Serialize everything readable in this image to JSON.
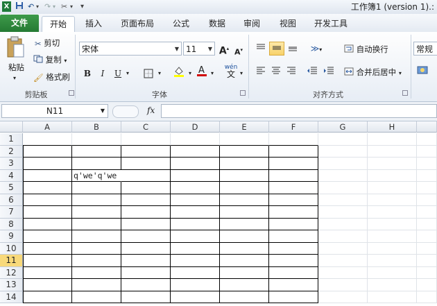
{
  "window": {
    "title": "工作簿1 (version 1).:"
  },
  "quick_access": {
    "excel_icon": "excel-icon",
    "save_icon": "save-icon",
    "undo_icon": "undo-icon",
    "redo_icon": "redo-icon",
    "customize": "▾"
  },
  "tabs": [
    {
      "label": "文件",
      "type": "file"
    },
    {
      "label": "开始",
      "active": true
    },
    {
      "label": "插入"
    },
    {
      "label": "页面布局"
    },
    {
      "label": "公式"
    },
    {
      "label": "数据"
    },
    {
      "label": "审阅"
    },
    {
      "label": "视图"
    },
    {
      "label": "开发工具"
    }
  ],
  "clipboard": {
    "paste_label": "粘贴",
    "cut_label": "剪切",
    "copy_label": "复制",
    "format_painter_label": "格式刷",
    "group_label": "剪贴板"
  },
  "font": {
    "name": "宋体",
    "size": "11",
    "bold": "B",
    "italic": "I",
    "underline": "U",
    "grow": "A",
    "shrink": "A",
    "group_label": "字体",
    "phonetic": "wén"
  },
  "alignment": {
    "wrap_label": "自动换行",
    "merge_label": "合并后居中",
    "group_label": "对齐方式"
  },
  "number": {
    "format": "常规"
  },
  "formula_bar": {
    "name_box": "N11",
    "fx": "fx",
    "content": ""
  },
  "sheet": {
    "columns": [
      "A",
      "B",
      "C",
      "D",
      "E",
      "F",
      "G",
      "H"
    ],
    "rows": [
      "1",
      "2",
      "3",
      "4",
      "5",
      "6",
      "7",
      "8",
      "9",
      "10",
      "11",
      "12",
      "13",
      "14"
    ],
    "selected_row": "11",
    "cells": {
      "B4": "q'we'q'we"
    }
  },
  "colors": {
    "file_tab": "#2e8b3e",
    "selection": "#f8d97a",
    "border": "#000000"
  }
}
